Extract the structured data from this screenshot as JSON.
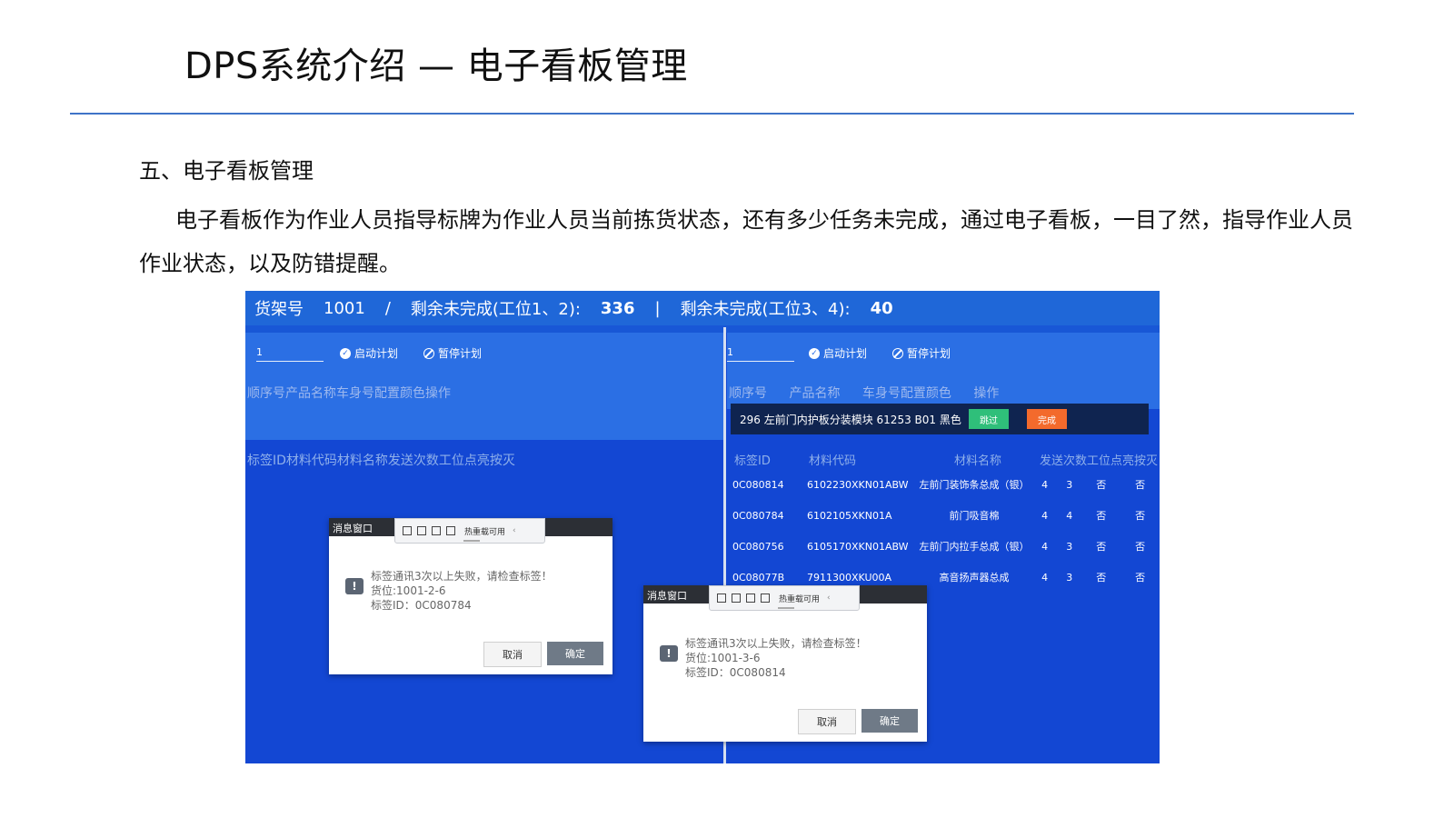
{
  "slide": {
    "title": "DPS系统介绍 — 电子看板管理",
    "section_heading": "五、电子看板管理",
    "paragraph": "电子看板作为作业人员指导标牌为作业人员当前拣货状态，还有多少任务未完成，通过电子看板，一目了然，指导作业人员作业状态，以及防错提醒。"
  },
  "app": {
    "header": {
      "shelf_label": "货架号",
      "shelf_value": "1001",
      "sep1": "/",
      "remain12_label": "剩余未完成(工位1、2):",
      "remain12_value": "336",
      "sep2": "|",
      "remain34_label": "剩余未完成(工位3、4):",
      "remain34_value": "40"
    },
    "left": {
      "plan_input": "1",
      "start_label": "启动计划",
      "pause_label": "暂停计划",
      "order_header": "顺序号产品名称车身号配置颜色操作",
      "tag_header": "标签ID材料代码材料名称发送次数工位点亮按灭"
    },
    "right": {
      "plan_input": "1",
      "start_label": "启动计划",
      "pause_label": "暂停计划",
      "order_cols": [
        "顺序号",
        "产品名称",
        "车身号配置颜色",
        "操作"
      ],
      "order_row": "296   左前门内护板分装模块  61253  B01  黑色",
      "skip_label": "跳过",
      "done_label": "完成",
      "tag_cols": [
        "标签ID",
        "材料代码",
        "材料名称",
        "发送次数工位点亮按灭"
      ],
      "tag_rows": [
        {
          "id": "0C080814",
          "code": "6102230XKN01ABW",
          "name": "左前门装饰条总成（银）",
          "sends": "4",
          "station": "3",
          "lit": "否",
          "off": "否"
        },
        {
          "id": "0C080784",
          "code": "6102105XKN01A",
          "name": "前门吸音棉",
          "sends": "4",
          "station": "4",
          "lit": "否",
          "off": "否"
        },
        {
          "id": "0C080756",
          "code": "6105170XKN01ABW",
          "name": "左前门内拉手总成（银）",
          "sends": "4",
          "station": "3",
          "lit": "否",
          "off": "否"
        },
        {
          "id": "0C08077B",
          "code": "7911300XKU00A",
          "name": "高音扬声器总成",
          "sends": "4",
          "station": "3",
          "lit": "否",
          "off": "否"
        }
      ]
    },
    "dialogs": [
      {
        "title": "消息窗口",
        "toolbar_label": "热重载可用",
        "line1": "标签通讯3次以上失败，请检查标签！",
        "line2": "货位:1001-2-6",
        "line3": "标签ID：0C080784",
        "cancel": "取消",
        "ok": "确定"
      },
      {
        "title": "消息窗口",
        "toolbar_label": "热重载可用",
        "line1": "标签通讯3次以上失败，请检查标签！",
        "line2": "货位:1001-3-6",
        "line3": "标签ID：0C080814",
        "cancel": "取消",
        "ok": "确定"
      }
    ]
  },
  "colors": {
    "title_rule": "#3f73c8",
    "app_background": "#1347d3",
    "skip_button": "#2fbf7a",
    "done_button": "#f36a2c"
  }
}
